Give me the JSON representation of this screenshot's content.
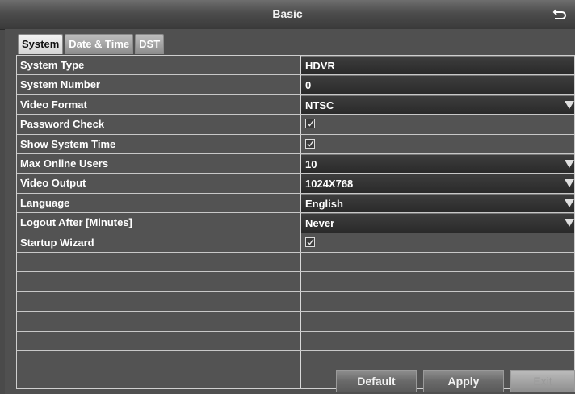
{
  "window": {
    "title": "Basic",
    "back_icon": "return-arrow-icon"
  },
  "tabs": [
    {
      "label": "System",
      "active": true
    },
    {
      "label": "Date & Time",
      "active": false
    },
    {
      "label": "DST",
      "active": false
    }
  ],
  "settings": [
    {
      "label": "System Type",
      "value": "HDVR",
      "control": "text"
    },
    {
      "label": "System Number",
      "value": "0",
      "control": "input"
    },
    {
      "label": "Video Format",
      "value": "NTSC",
      "control": "select"
    },
    {
      "label": "Password Check",
      "value": "",
      "control": "checkbox",
      "checked": true
    },
    {
      "label": "Show System Time",
      "value": "",
      "control": "checkbox",
      "checked": true
    },
    {
      "label": "Max Online Users",
      "value": "10",
      "control": "select"
    },
    {
      "label": "Video Output",
      "value": "1024X768",
      "control": "select"
    },
    {
      "label": "Language",
      "value": "English",
      "control": "select"
    },
    {
      "label": "Logout After [Minutes]",
      "value": "Never",
      "control": "select"
    },
    {
      "label": "Startup Wizard",
      "value": "",
      "control": "checkbox",
      "checked": true
    }
  ],
  "footer": {
    "default_label": "Default",
    "apply_label": "Apply",
    "exit_label": "Exit"
  }
}
